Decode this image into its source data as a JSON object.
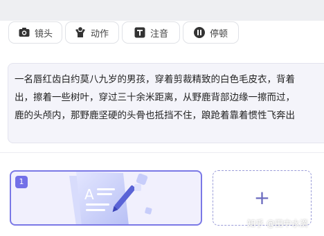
{
  "toolbar": {
    "buttons": [
      {
        "label": "镜头",
        "icon": "camera-icon"
      },
      {
        "label": "动作",
        "icon": "person-action-icon"
      },
      {
        "label": "注音",
        "icon": "text-t-icon"
      },
      {
        "label": "停顿",
        "icon": "pause-icon"
      }
    ]
  },
  "script_text": {
    "lines": [
      "一名唇红齿白约莫八九岁的男孩，穿着剪裁精致的白色毛皮衣，背着",
      "出，擦着一些树叶，穿过三十余米距离，从野鹿背部边缘一擦而过，",
      "鹿的头颅内，那野鹿坚硬的头骨也抵挡不住，踉跄着靠着惯性飞奔出"
    ]
  },
  "scenes": {
    "items": [
      {
        "number": "1"
      }
    ],
    "add_symbol": "+"
  },
  "watermark": "知乎 @田中水滴",
  "colors": {
    "accent": "#7370e8",
    "text_bg": "#f4f4fa"
  }
}
